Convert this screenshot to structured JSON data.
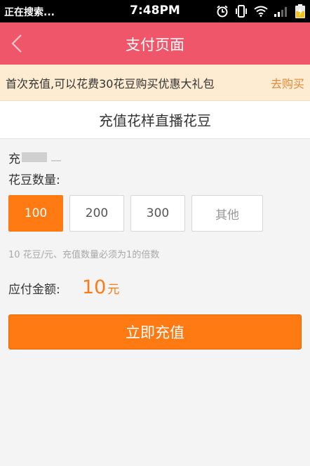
{
  "status_bar": {
    "left_text": "正在搜索...",
    "time": "7:48PM"
  },
  "nav": {
    "title": "支付页面"
  },
  "promo": {
    "text": "首次充值,可以花费30花豆购买优惠大礼包",
    "link": "去购买"
  },
  "card": {
    "title": "充值花样直播花豆"
  },
  "form": {
    "account_prefix": "充",
    "quantity_label": "花豆数量:",
    "options": [
      {
        "label": "100",
        "selected": true
      },
      {
        "label": "200",
        "selected": false
      },
      {
        "label": "300",
        "selected": false
      },
      {
        "label": "其他",
        "selected": false
      }
    ],
    "hint": "10 花豆/元、充值数量必须为1的倍数",
    "amount_label": "应付金额:",
    "amount_value": "10",
    "amount_unit": "元",
    "submit_label": "立即充值"
  },
  "colors": {
    "nav_bg": "#f0566a",
    "accent": "#ff7a12",
    "promo_bg": "#fdebd2",
    "promo_link": "#e08a3a"
  },
  "icons": {
    "back": "chevron-left-icon",
    "alarm": "alarm-icon",
    "vibrate": "vibrate-icon",
    "wifi": "wifi-icon",
    "signal": "signal-icon",
    "battery": "battery-charging-icon"
  }
}
